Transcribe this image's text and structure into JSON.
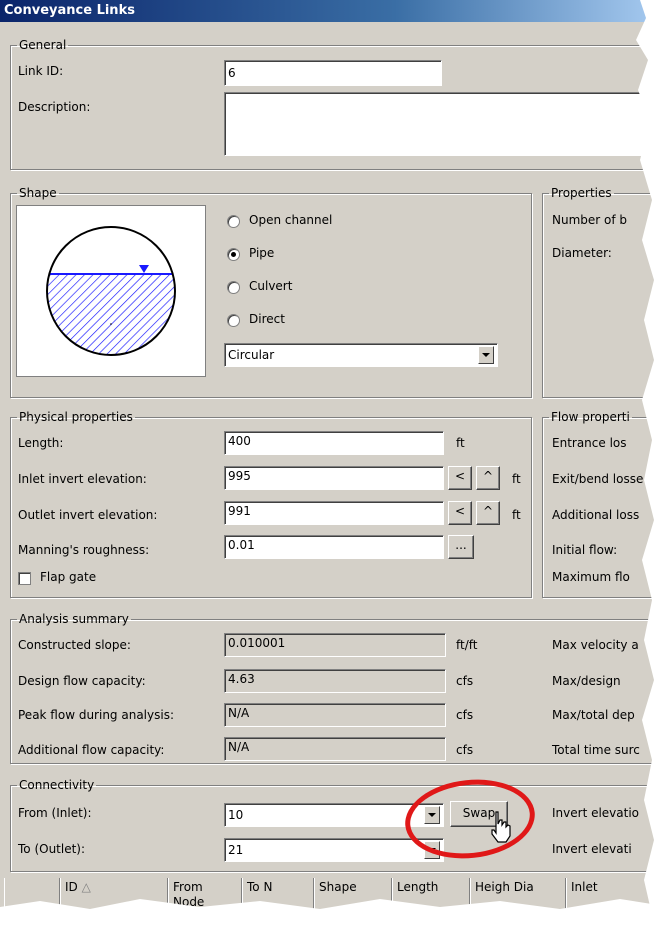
{
  "window": {
    "title": "Conveyance Links"
  },
  "general": {
    "legend": "General",
    "link_id_label": "Link ID:",
    "link_id_value": "6",
    "description_label": "Description:",
    "description_value": ""
  },
  "shape": {
    "legend": "Shape",
    "options": [
      "Open channel",
      "Pipe",
      "Culvert",
      "Direct"
    ],
    "selected": "Pipe",
    "cross_section": "Circular"
  },
  "properties": {
    "legend": "Properties",
    "rows": [
      "Number of b",
      "Diameter:"
    ]
  },
  "physical": {
    "legend": "Physical properties",
    "length_label": "Length:",
    "length_value": "400",
    "length_unit": "ft",
    "inlet_label": "Inlet invert elevation:",
    "inlet_value": "995",
    "inlet_unit": "ft",
    "outlet_label": "Outlet invert elevation:",
    "outlet_value": "991",
    "outlet_unit": "ft",
    "manning_label": "Manning's roughness:",
    "manning_value": "0.01",
    "flap_gate_label": "Flap gate",
    "ellipsis": "...",
    "lt": "<",
    "caret": "^"
  },
  "flow": {
    "legend": "Flow properti",
    "rows": [
      "Entrance los",
      "Exit/bend losse",
      "Additional loss",
      "Initial flow:",
      "Maximum flo"
    ]
  },
  "analysis": {
    "legend": "Analysis summary",
    "rows": [
      {
        "label": "Constructed slope:",
        "value": "0.010001",
        "unit": "ft/ft",
        "right": "Max velocity a"
      },
      {
        "label": "Design flow capacity:",
        "value": "4.63",
        "unit": "cfs",
        "right": "Max/design"
      },
      {
        "label": "Peak flow during analysis:",
        "value": "N/A",
        "unit": "cfs",
        "right": "Max/total dep"
      },
      {
        "label": "Additional flow capacity:",
        "value": "N/A",
        "unit": "cfs",
        "right": "Total time surc"
      }
    ]
  },
  "connectivity": {
    "legend": "Connectivity",
    "from_label": "From (Inlet):",
    "from_value": "10",
    "to_label": "To (Outlet):",
    "to_value": "21",
    "swap_label": "Swap",
    "invert_1": "Invert elevatio",
    "invert_2": "Invert elevati"
  },
  "grid": {
    "columns": [
      "ID",
      "From Node",
      "To N",
      "Shape",
      "Length",
      "Heigh Dia",
      "Inlet"
    ]
  },
  "colors": {
    "water": "#1a1aff",
    "highlight_circle": "#e01818",
    "titlebar": "#0a246a"
  }
}
